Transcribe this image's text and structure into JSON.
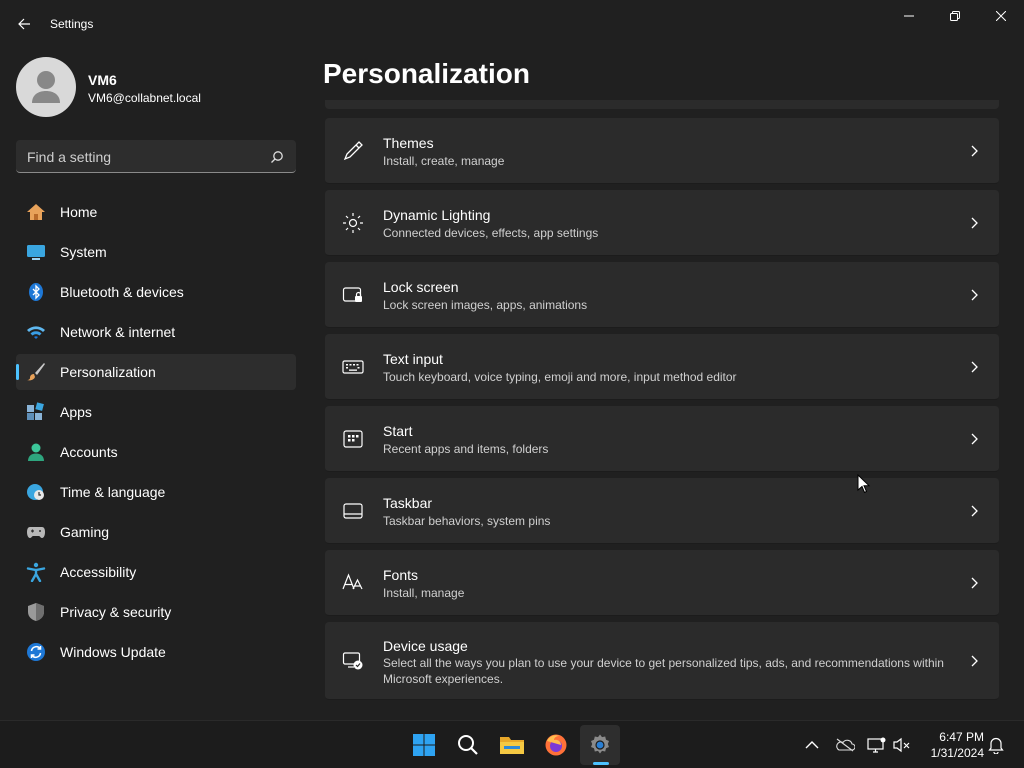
{
  "window": {
    "title": "Settings"
  },
  "profile": {
    "name": "VM6",
    "email": "VM6@collabnet.local"
  },
  "search": {
    "placeholder": "Find a setting"
  },
  "sidebar": {
    "items": [
      {
        "label": "Home",
        "icon": "home-icon"
      },
      {
        "label": "System",
        "icon": "system-icon"
      },
      {
        "label": "Bluetooth & devices",
        "icon": "bluetooth-icon"
      },
      {
        "label": "Network & internet",
        "icon": "wifi-icon"
      },
      {
        "label": "Personalization",
        "icon": "paintbrush-icon",
        "active": true
      },
      {
        "label": "Apps",
        "icon": "apps-icon"
      },
      {
        "label": "Accounts",
        "icon": "accounts-icon"
      },
      {
        "label": "Time & language",
        "icon": "time-language-icon"
      },
      {
        "label": "Gaming",
        "icon": "gamepad-icon"
      },
      {
        "label": "Accessibility",
        "icon": "accessibility-icon"
      },
      {
        "label": "Privacy & security",
        "icon": "shield-icon"
      },
      {
        "label": "Windows Update",
        "icon": "windows-update-icon"
      }
    ]
  },
  "main": {
    "title": "Personalization",
    "cards": [
      {
        "title": "Themes",
        "subtitle": "Install, create, manage",
        "icon": "pen-icon"
      },
      {
        "title": "Dynamic Lighting",
        "subtitle": "Connected devices, effects, app settings",
        "icon": "lighting-icon"
      },
      {
        "title": "Lock screen",
        "subtitle": "Lock screen images, apps, animations",
        "icon": "lock-screen-icon"
      },
      {
        "title": "Text input",
        "subtitle": "Touch keyboard, voice typing, emoji and more, input method editor",
        "icon": "keyboard-icon"
      },
      {
        "title": "Start",
        "subtitle": "Recent apps and items, folders",
        "icon": "start-icon"
      },
      {
        "title": "Taskbar",
        "subtitle": "Taskbar behaviors, system pins",
        "icon": "taskbar-icon"
      },
      {
        "title": "Fonts",
        "subtitle": "Install, manage",
        "icon": "fonts-icon"
      },
      {
        "title": "Device usage",
        "subtitle": "Select all the ways you plan to use your device to get personalized tips, ads, and recommendations within Microsoft experiences.",
        "icon": "device-usage-icon"
      }
    ]
  },
  "taskbar": {
    "apps": [
      "windows-start-icon",
      "search-icon",
      "file-explorer-icon",
      "firefox-icon",
      "settings-gear-icon"
    ],
    "tray": [
      "chevron-up-icon",
      "onedrive-icon",
      "network-icon",
      "volume-muted-icon",
      "notification-bell-icon"
    ],
    "time": "6:47 PM",
    "date": "1/31/2024"
  },
  "colors": {
    "background": "#202020",
    "card": "#2b2b2b",
    "accent": "#4cc2ff"
  }
}
